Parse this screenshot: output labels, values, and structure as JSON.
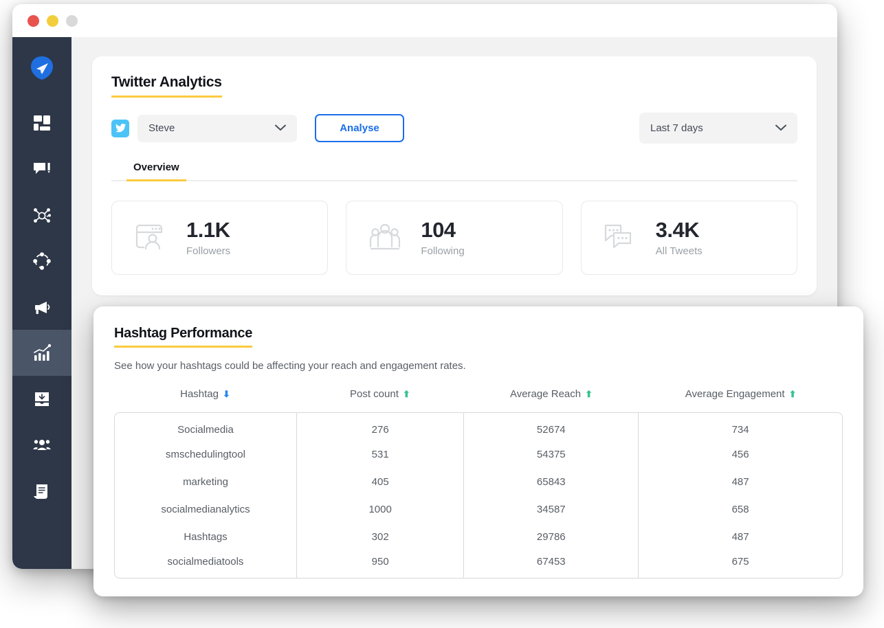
{
  "window": {
    "traffic_lights": [
      "close",
      "minimize",
      "maximize"
    ]
  },
  "sidebar": {
    "logo": "paper-plane-logo",
    "items": [
      {
        "icon": "dashboard-grid-icon",
        "name": "dashboard",
        "active": false
      },
      {
        "icon": "compose-message-icon",
        "name": "compose",
        "active": false
      },
      {
        "icon": "network-nodes-icon",
        "name": "network",
        "active": false
      },
      {
        "icon": "target-circle-icon",
        "name": "discovery",
        "active": false
      },
      {
        "icon": "megaphone-icon",
        "name": "campaigns",
        "active": false
      },
      {
        "icon": "bar-chart-trend-icon",
        "name": "analytics",
        "active": true
      },
      {
        "icon": "inbox-download-icon",
        "name": "inbox",
        "active": false
      },
      {
        "icon": "team-people-icon",
        "name": "team",
        "active": false
      },
      {
        "icon": "document-report-icon",
        "name": "reports",
        "active": false
      }
    ]
  },
  "analytics": {
    "title": "Twitter Analytics",
    "account_platform_icon": "twitter-bird-icon",
    "account_value": "Steve",
    "analyse_label": "Analyse",
    "date_range_value": "Last 7 days",
    "tabs": [
      {
        "label": "Overview",
        "active": true
      }
    ],
    "stats": [
      {
        "icon": "profile-window-icon",
        "value": "1.1K",
        "label": "Followers"
      },
      {
        "icon": "people-group-icon",
        "value": "104",
        "label": "Following"
      },
      {
        "icon": "speech-bubbles-icon",
        "value": "3.4K",
        "label": "All Tweets"
      }
    ]
  },
  "hashtag": {
    "title": "Hashtag Performance",
    "subtitle": "See how your hashtags could be affecting your reach and engagement rates.",
    "columns": [
      {
        "label": "Hashtag",
        "sort": "down"
      },
      {
        "label": "Post count",
        "sort": "up"
      },
      {
        "label": "Average Reach",
        "sort": "up"
      },
      {
        "label": "Average Engagement",
        "sort": "up"
      }
    ],
    "rows": [
      {
        "hashtag": "Socialmedia",
        "post_count": "276",
        "avg_reach": "52674",
        "avg_engagement": "734"
      },
      {
        "hashtag": "smschedulingtool",
        "post_count": "531",
        "avg_reach": "54375",
        "avg_engagement": "456"
      },
      {
        "hashtag": "marketing",
        "post_count": "405",
        "avg_reach": "65843",
        "avg_engagement": "487"
      },
      {
        "hashtag": "socialmedianalytics",
        "post_count": "1000",
        "avg_reach": "34587",
        "avg_engagement": "658"
      },
      {
        "hashtag": "Hashtags",
        "post_count": "302",
        "avg_reach": "29786",
        "avg_engagement": "487"
      },
      {
        "hashtag": "socialmediatools",
        "post_count": "950",
        "avg_reach": "67453",
        "avg_engagement": "675"
      }
    ]
  },
  "colors": {
    "sidebar_bg": "#2d3748",
    "sidebar_active": "#4a5568",
    "accent_yellow": "#fbca3e",
    "accent_blue": "#1a6ee8",
    "twitter_blue": "#4cc3f7",
    "sort_up_green": "#35c28e",
    "sort_down_blue": "#2e86f0"
  }
}
